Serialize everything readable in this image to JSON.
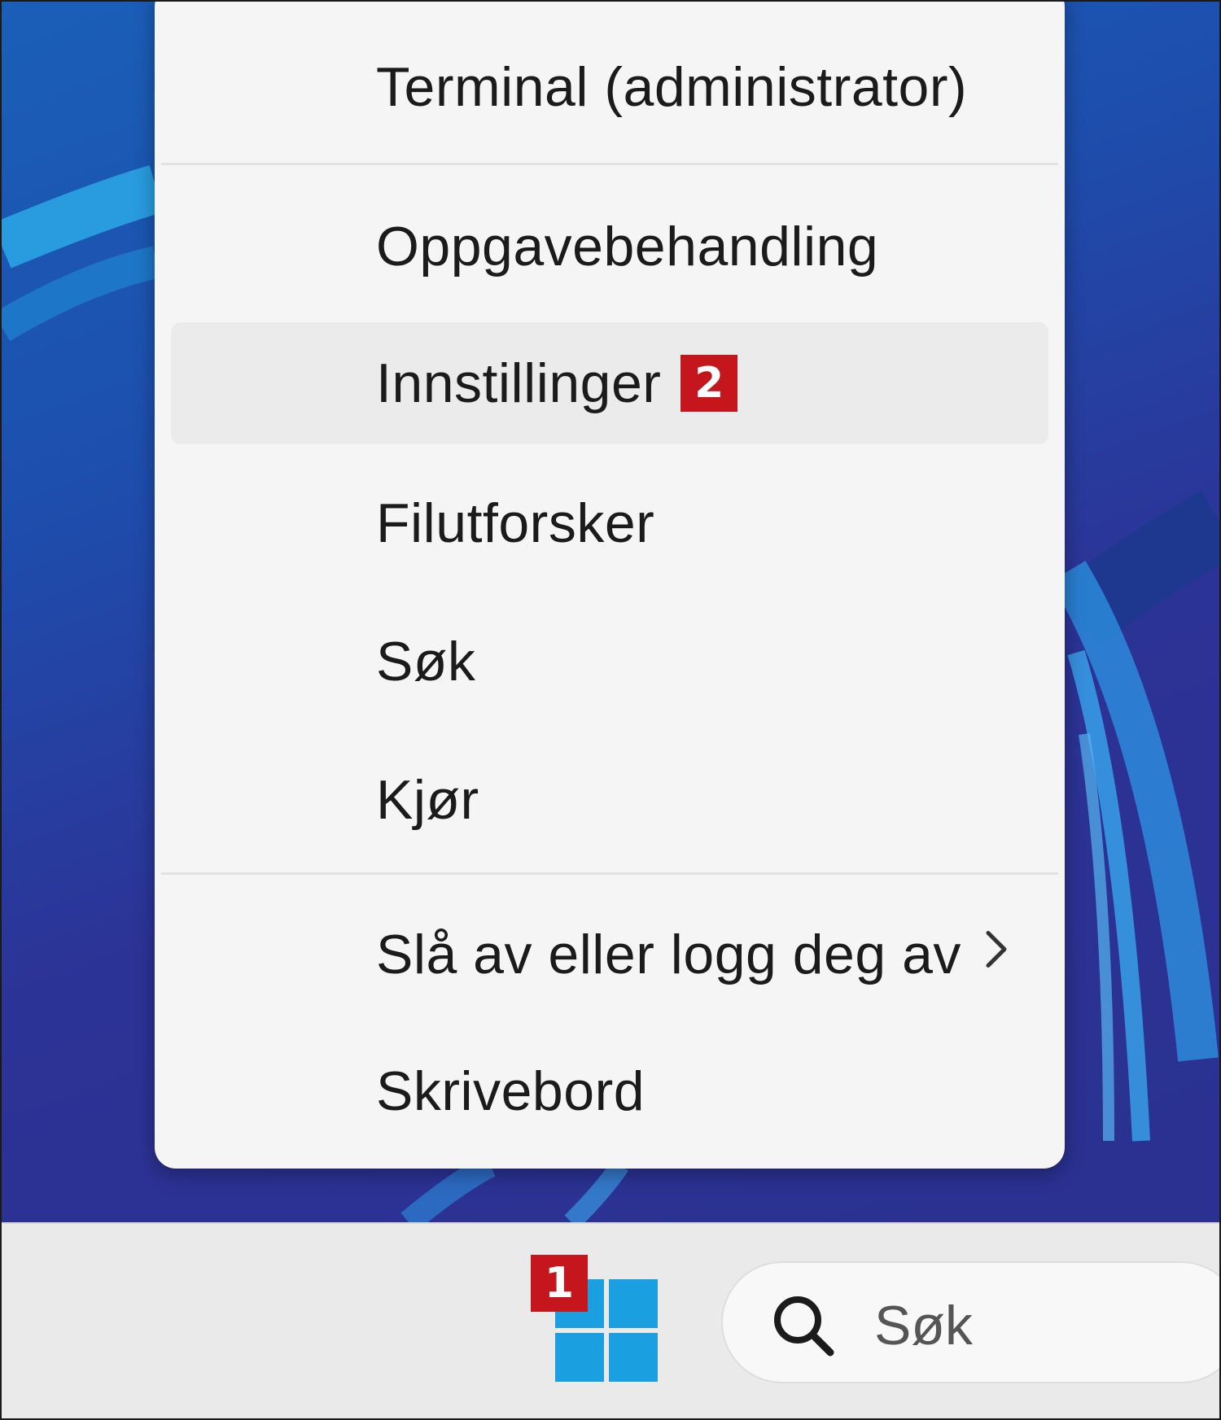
{
  "context_menu": {
    "items": [
      {
        "label": "Terminal (administrator)"
      },
      {
        "label": "Oppgavebehandling"
      },
      {
        "label": "Innstillinger",
        "badge": "2"
      },
      {
        "label": "Filutforsker"
      },
      {
        "label": "Søk"
      },
      {
        "label": "Kjør"
      },
      {
        "label": "Slå av eller logg deg av",
        "has_submenu": true
      },
      {
        "label": "Skrivebord"
      }
    ]
  },
  "taskbar": {
    "start_badge": "1",
    "search_label": "Søk"
  },
  "colors": {
    "badge": "#c4161c",
    "menu_background": "#f5f5f5",
    "taskbar": "#eaeaea",
    "windows_logo": "#1a9fe0"
  },
  "icons": {
    "start": "windows-logo-icon",
    "search": "search-icon",
    "submenu": "chevron-right-icon"
  }
}
